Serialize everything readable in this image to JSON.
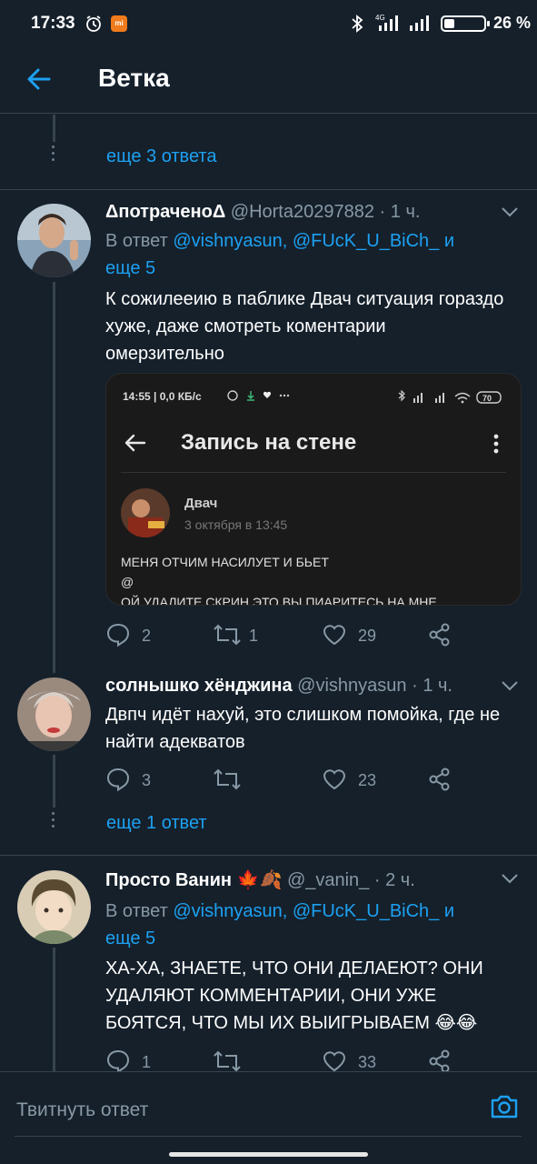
{
  "status_bar": {
    "time": "17:33",
    "network": "4G",
    "battery": "26 %"
  },
  "app_bar": {
    "title": "Ветка"
  },
  "threads": {
    "more_replies_1": "еще 3 ответа",
    "more_replies_2": "еще 1 ответ"
  },
  "tweets": [
    {
      "name": "ΔпотраченоΔ",
      "handle": "@Horta20297882",
      "time": "· 1 ч.",
      "reply_prefix": "В ответ",
      "mention_1": "@vishnyasun",
      "mention_2": "@FUcK_U_BiCh_",
      "reply_and": "и",
      "reply_more": "еще 5",
      "text": "К сожилееию в паблике Двач ситуация гораздо хуже, даже смотреть коментарии омерзительно",
      "replies": "2",
      "retweets": "1",
      "likes": "29",
      "media": {
        "status_time": "14:55 | 0,0 КБ/с",
        "battery": "70",
        "screen_title": "Запись на стене",
        "author": "Двач",
        "date": "3 октября в 13:45",
        "post_line_1": "МЕНЯ ОТЧИМ НАСИЛУЕТ И БЬЕТ",
        "post_line_2": "@",
        "post_line_3": "ОЙ УДАЛИТЕ СКРИН ЭТО ВЫ ПИАРИТЕСЬ НА МНЕ"
      }
    },
    {
      "name": "солнышко хёнджина",
      "handle": "@vishnyasun",
      "time": "· 1 ч.",
      "text": "Двпч идёт нахуй, это слишком помойка, где не найти адекватов",
      "replies": "3",
      "retweets": "",
      "likes": "23"
    },
    {
      "name": "Просто Ванин",
      "name_emoji": "🍁🍂",
      "handle": "@_vanin_",
      "time": "· 2 ч.",
      "reply_prefix": "В ответ",
      "mention_1": "@vishnyasun",
      "mention_2": "@FUcK_U_BiCh_",
      "reply_and": "и",
      "reply_more": "еще 5",
      "text": "ХА-ХА, ЗНАЕТЕ, ЧТО ОНИ ДЕЛАЕЮТ? ОНИ УДАЛЯЮТ КОММЕНТАРИИ, ОНИ УЖЕ БОЯТСЯ, ЧТО МЫ ИХ ВЫИГРЫВАЕМ 😂😂",
      "replies": "1",
      "retweets": "",
      "likes": "33"
    }
  ],
  "composer": {
    "placeholder": "Твитнуть ответ"
  },
  "colors": {
    "background": "#15202b",
    "accent": "#1da1f2",
    "muted": "#8899a6",
    "divider": "#38444d"
  }
}
